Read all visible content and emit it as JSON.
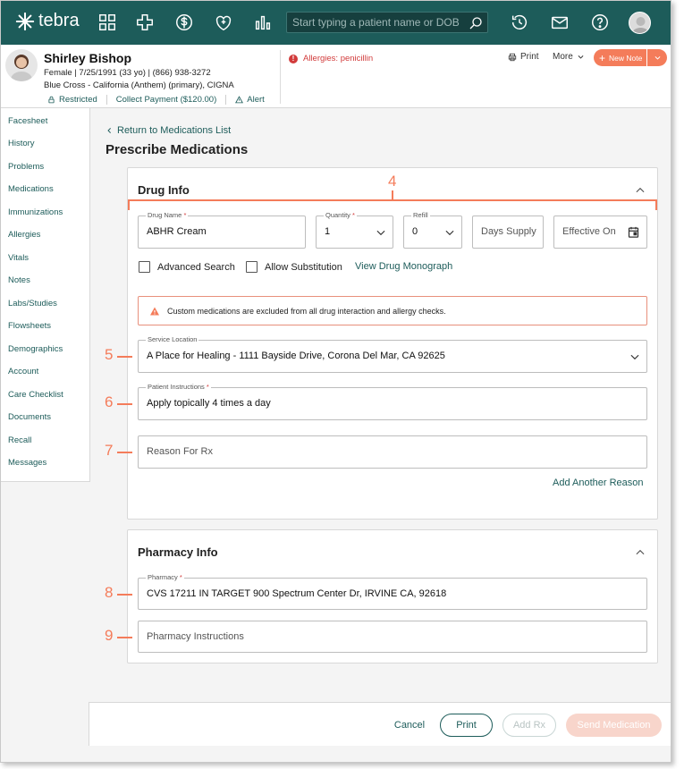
{
  "app": {
    "logo_text": "tebra"
  },
  "topbar": {
    "search_placeholder": "Start typing a patient name or DOB",
    "icons": [
      "grid-icon",
      "plus-cross-icon",
      "dollar-icon",
      "heart-shield-icon",
      "bar-chart-icon",
      "history-icon",
      "mail-icon",
      "help-icon"
    ]
  },
  "patient": {
    "name": "Shirley Bishop",
    "demographics": "Female | 7/25/1991 (33 yo) | (866) 938-3272",
    "insurance": "Blue Cross - California (Anthem) (primary), CIGNA",
    "links": {
      "restricted": "Restricted",
      "collect": "Collect Payment ($120.00)",
      "alert": "Alert"
    },
    "allergies": "Allergies: penicillin"
  },
  "header_actions": {
    "print": "Print",
    "more": "More",
    "new_note": "New Note"
  },
  "sidebar": {
    "items": [
      "Facesheet",
      "History",
      "Problems",
      "Medications",
      "Immunizations",
      "Allergies",
      "Vitals",
      "Notes",
      "Labs/Studies",
      "Flowsheets",
      "Demographics",
      "Account",
      "Care Checklist",
      "Documents",
      "Recall",
      "Messages"
    ]
  },
  "main": {
    "back_link": "Return to Medications List",
    "title": "Prescribe Medications"
  },
  "drug_info": {
    "title": "Drug Info",
    "drug_name": {
      "label": "Drug Name",
      "value": "ABHR Cream"
    },
    "quantity": {
      "label": "Quantity",
      "value": "1"
    },
    "refill": {
      "label": "Refill",
      "value": "0"
    },
    "days_supply": {
      "placeholder": "Days Supply"
    },
    "effective_on": {
      "placeholder": "Effective On"
    },
    "advanced_search": "Advanced Search",
    "allow_substitution": "Allow Substitution",
    "drug_monograph": "View Drug Monograph",
    "warning": "Custom medications are excluded from all drug interaction and allergy checks.",
    "service_location": {
      "label": "Service Location",
      "value": "A Place for Healing - 1111 Bayside Drive, Corona Del Mar, CA 92625"
    },
    "patient_instructions": {
      "label": "Patient Instructions",
      "value": "Apply topically 4 times a day"
    },
    "reason": {
      "placeholder": "Reason For Rx"
    },
    "add_reason": "Add Another Reason"
  },
  "pharmacy_info": {
    "title": "Pharmacy Info",
    "pharmacy": {
      "label": "Pharmacy",
      "value": "CVS 17211 IN TARGET 900 Spectrum Center Dr, IRVINE CA, 92618"
    },
    "instructions": {
      "placeholder": "Pharmacy Instructions"
    }
  },
  "annotations": [
    "4",
    "5",
    "6",
    "7",
    "8",
    "9"
  ],
  "footer": {
    "cancel": "Cancel",
    "print": "Print",
    "add_rx": "Add Rx",
    "send": "Send Medication"
  },
  "colors": {
    "brand": "#1d5c5a",
    "accent": "#f47c5a",
    "error": "#d23b3b"
  }
}
